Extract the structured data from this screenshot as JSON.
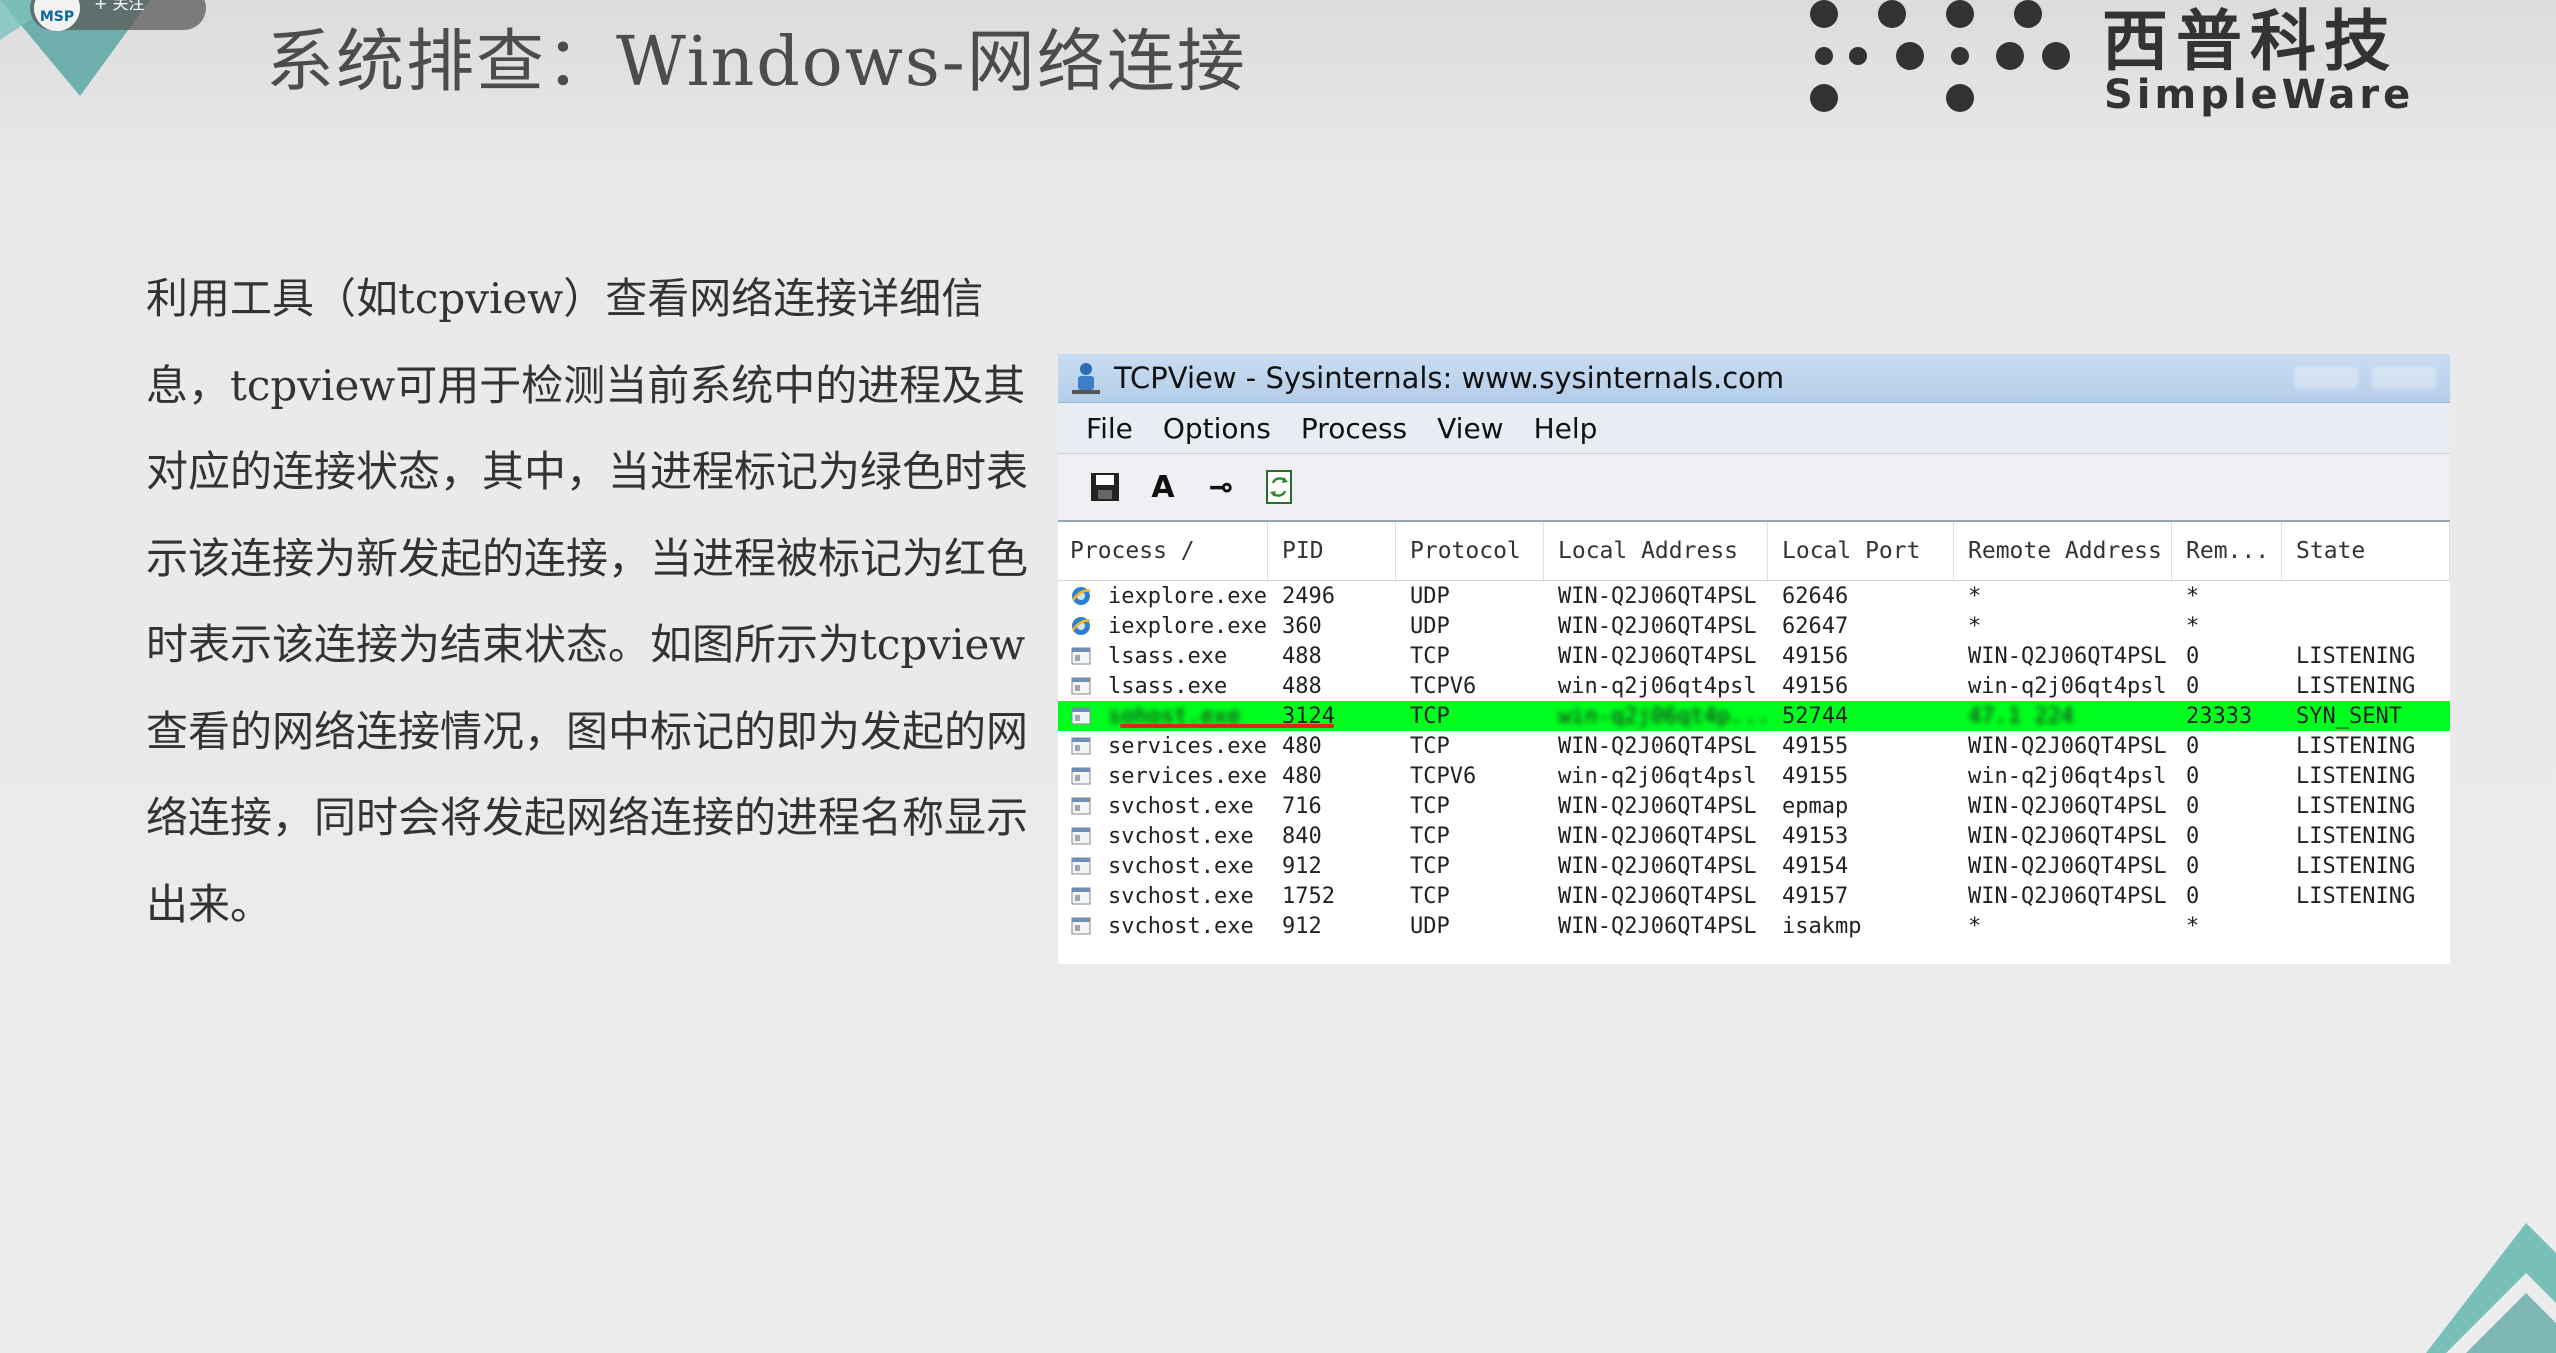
{
  "slide": {
    "badge_logo": "MSP",
    "badge_text": "+ 关注",
    "title": "系统排查：Windows-网络连接",
    "brand_cn": "西普科技",
    "brand_en": "SimpleWare",
    "body": "利用工具（如tcpview）查看网络连接详细信息，tcpview可用于检测当前系统中的进程及其对应的连接状态，其中，当进程标记为绿色时表示该连接为新发起的连接，当进程被标记为红色时表示该连接为结束状态。如图所示为tcpview查看的网络连接情况，图中标记的即为发起的网络连接，同时会将发起网络连接的进程名称显示出来。"
  },
  "tcpview": {
    "title": "TCPView - Sysinternals: www.sysinternals.com",
    "menu": [
      "File",
      "Options",
      "Process",
      "View",
      "Help"
    ],
    "toolbar": {
      "save_icon": "save-icon",
      "font_label": "A",
      "font_icon": "font-icon",
      "connect_label": "⊸",
      "connect_icon": "connect-icon",
      "refresh_icon": "refresh-icon"
    },
    "columns": [
      "Process  /",
      "PID",
      "Protocol",
      "Local Address",
      "Local Port",
      "Remote Address",
      "Rem...",
      "State"
    ],
    "highlight_color": "#00ff1e",
    "underline_color": "#e0241b",
    "rows": [
      {
        "icon": "ie-icon",
        "process": "iexplore.exe",
        "pid": "2496",
        "protocol": "UDP",
        "local_address": "WIN-Q2J06QT4PSL",
        "local_port": "62646",
        "remote_address": "*",
        "remote_port": "*",
        "state": ""
      },
      {
        "icon": "ie-icon",
        "process": "iexplore.exe",
        "pid": "360",
        "protocol": "UDP",
        "local_address": "WIN-Q2J06QT4PSL",
        "local_port": "62647",
        "remote_address": "*",
        "remote_port": "*",
        "state": ""
      },
      {
        "icon": "process-icon",
        "process": "lsass.exe",
        "pid": "488",
        "protocol": "TCP",
        "local_address": "WIN-Q2J06QT4PSL",
        "local_port": "49156",
        "remote_address": "WIN-Q2J06QT4PSL",
        "remote_port": "0",
        "state": "LISTENING"
      },
      {
        "icon": "process-icon",
        "process": "lsass.exe",
        "pid": "488",
        "protocol": "TCPV6",
        "local_address": "win-q2j06qt4psl",
        "local_port": "49156",
        "remote_address": "win-q2j06qt4psl",
        "remote_port": "0",
        "state": "LISTENING"
      },
      {
        "icon": "process-icon",
        "process": "sohost.exe",
        "pid": "3124",
        "protocol": "TCP",
        "local_address": "win-q2j06qt4p...",
        "local_port": "52744",
        "remote_address": "47.1      224",
        "remote_port": "23333",
        "state": "SYN_SENT",
        "active": true
      },
      {
        "icon": "process-icon",
        "process": "services.exe",
        "pid": "480",
        "protocol": "TCP",
        "local_address": "WIN-Q2J06QT4PSL",
        "local_port": "49155",
        "remote_address": "WIN-Q2J06QT4PSL",
        "remote_port": "0",
        "state": "LISTENING"
      },
      {
        "icon": "process-icon",
        "process": "services.exe",
        "pid": "480",
        "protocol": "TCPV6",
        "local_address": "win-q2j06qt4psl",
        "local_port": "49155",
        "remote_address": "win-q2j06qt4psl",
        "remote_port": "0",
        "state": "LISTENING"
      },
      {
        "icon": "process-icon",
        "process": "svchost.exe",
        "pid": "716",
        "protocol": "TCP",
        "local_address": "WIN-Q2J06QT4PSL",
        "local_port": "epmap",
        "remote_address": "WIN-Q2J06QT4PSL",
        "remote_port": "0",
        "state": "LISTENING"
      },
      {
        "icon": "process-icon",
        "process": "svchost.exe",
        "pid": "840",
        "protocol": "TCP",
        "local_address": "WIN-Q2J06QT4PSL",
        "local_port": "49153",
        "remote_address": "WIN-Q2J06QT4PSL",
        "remote_port": "0",
        "state": "LISTENING"
      },
      {
        "icon": "process-icon",
        "process": "svchost.exe",
        "pid": "912",
        "protocol": "TCP",
        "local_address": "WIN-Q2J06QT4PSL",
        "local_port": "49154",
        "remote_address": "WIN-Q2J06QT4PSL",
        "remote_port": "0",
        "state": "LISTENING"
      },
      {
        "icon": "process-icon",
        "process": "svchost.exe",
        "pid": "1752",
        "protocol": "TCP",
        "local_address": "WIN-Q2J06QT4PSL",
        "local_port": "49157",
        "remote_address": "WIN-Q2J06QT4PSL",
        "remote_port": "0",
        "state": "LISTENING"
      },
      {
        "icon": "process-icon",
        "process": "svchost.exe",
        "pid": "912",
        "protocol": "UDP",
        "local_address": "WIN-Q2J06QT4PSL",
        "local_port": "isakmp",
        "remote_address": "*",
        "remote_port": "*",
        "state": ""
      }
    ]
  }
}
